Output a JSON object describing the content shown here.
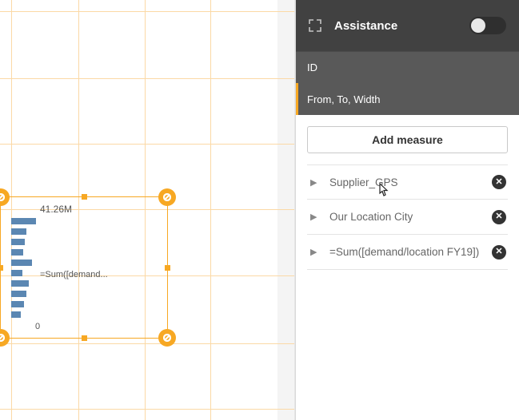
{
  "panel": {
    "assistance_label": "Assistance",
    "assistance_on": false,
    "sections": {
      "id_label": "ID",
      "fromto_label": "From, To, Width"
    },
    "add_button": "Add measure",
    "measures": [
      {
        "label": "Supplier_GPS"
      },
      {
        "label": "Our Location City"
      },
      {
        "label": "=Sum([demand/location FY19])"
      }
    ]
  },
  "selection": {
    "top_label": "41.26M",
    "formula_label": "=Sum([demand...",
    "zero_label": "0"
  },
  "chart_data": {
    "type": "bar",
    "orientation": "horizontal",
    "title": "",
    "xlabel": "",
    "ylabel": "",
    "ylim": [
      0,
      41260000
    ],
    "y_tick_top": "41.26M",
    "y_tick_bottom": "0",
    "series": [
      {
        "name": "=Sum([demand/location FY19])",
        "values": [
          38000000,
          23000000,
          21000000,
          18000000,
          32000000,
          17000000,
          27000000,
          23000000,
          19000000,
          14000000
        ]
      }
    ]
  },
  "colors": {
    "accent": "#f7a823",
    "bar": "#5b87b2",
    "panel_dark": "#414141",
    "panel_dark2": "#595959"
  }
}
